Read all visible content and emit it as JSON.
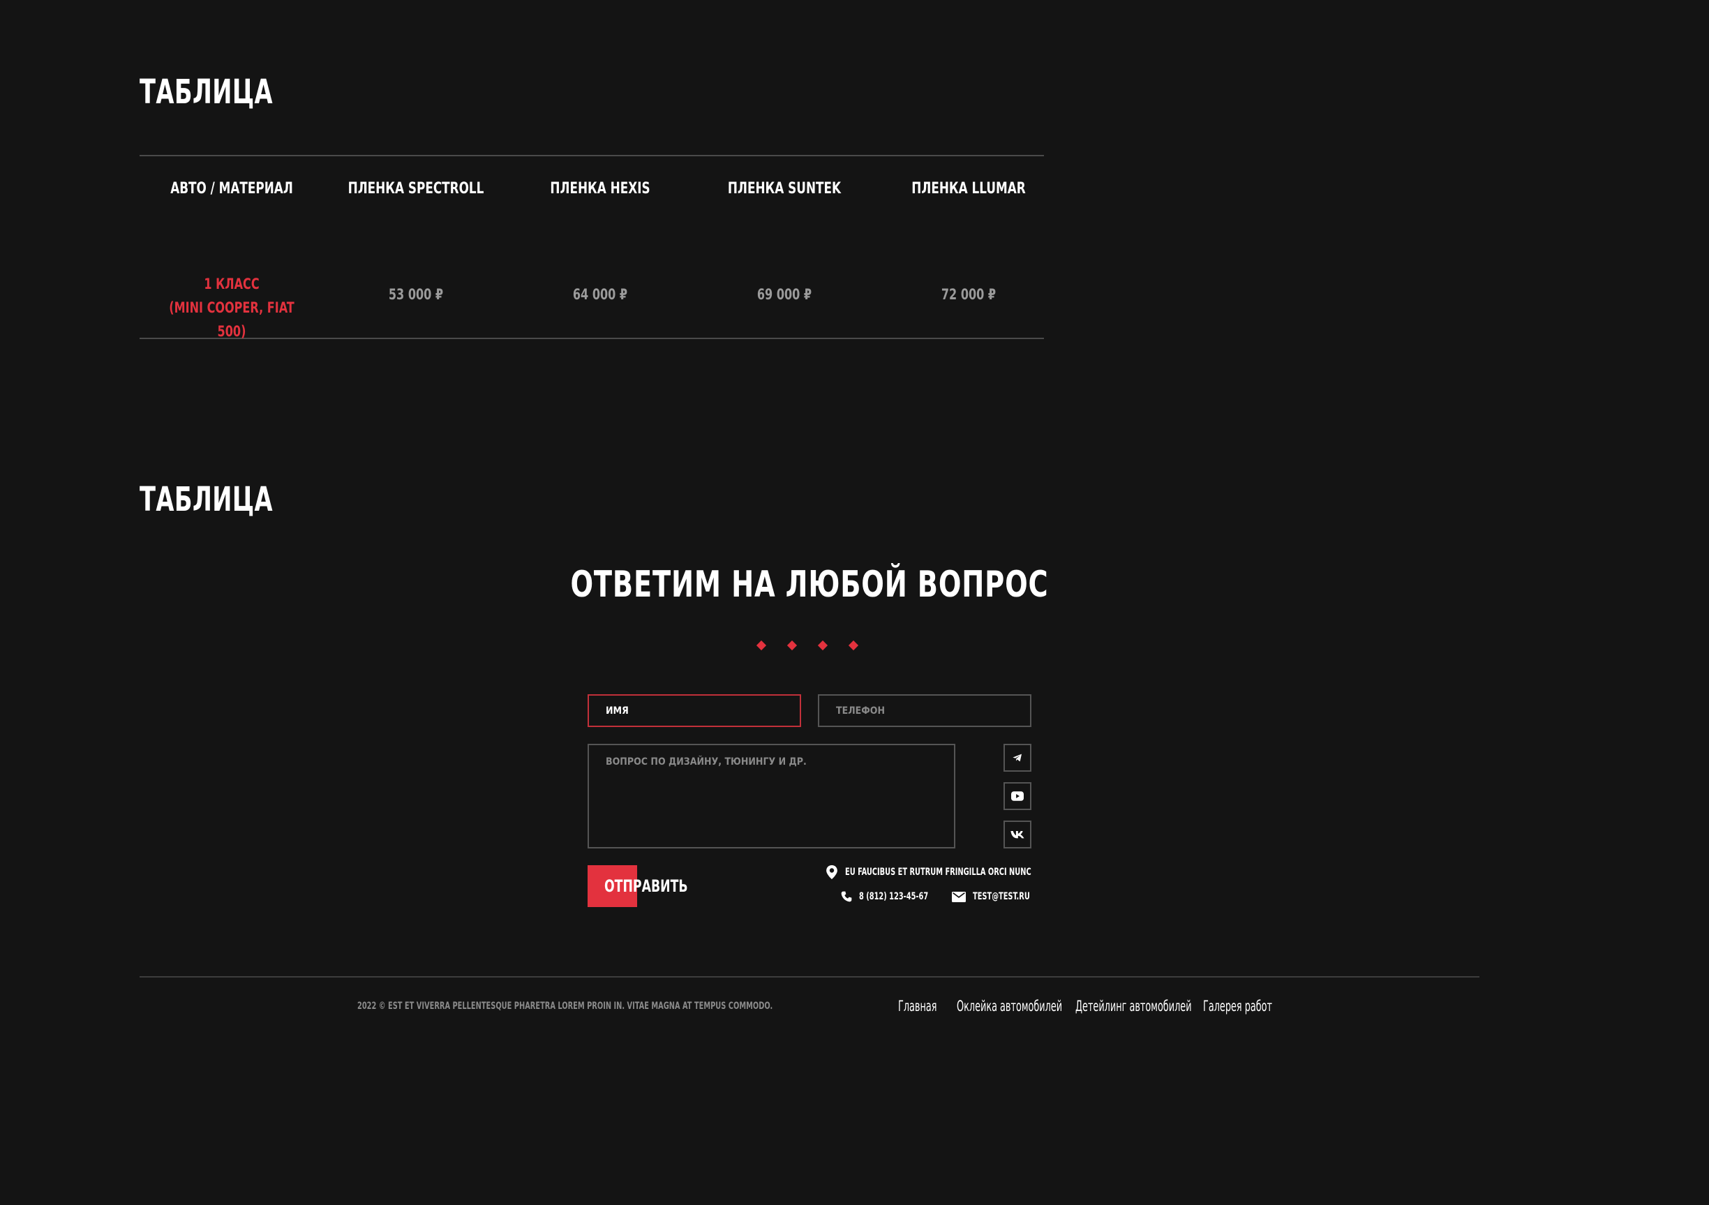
{
  "sections": [
    {
      "title": "ТАБЛИЦА"
    },
    {
      "title": "ТАБЛИЦА"
    }
  ],
  "table": {
    "headers": [
      "АВТО / МАТЕРИАЛ",
      "ПЛЕНКА SPECTROLL",
      "ПЛЕНКА HEXIS",
      "ПЛЕНКА SUNTEK",
      "ПЛЕНКА LLUMAR"
    ],
    "rows": [
      {
        "class_line1": "1 КЛАСС",
        "class_line2": "(MINI COOPER, FIAT 500)",
        "prices": [
          "53 000 ₽",
          "64 000 ₽",
          "69 000 ₽",
          "72 000 ₽"
        ]
      }
    ]
  },
  "contact": {
    "title": "ОТВЕТИМ НА ЛЮБОЙ ВОПРОС",
    "name_value": "ИМЯ",
    "phone_placeholder": "ТЕЛЕФОН",
    "question_placeholder": "ВОПРОС ПО ДИЗАЙНУ, ТЮНИНГУ И ДР.",
    "submit_label": "ОТПРАВИТЬ",
    "address": "EU FAUCIBUS ET RUTRUM FRINGILLA ORCI NUNC",
    "phone": "8 (812) 123-45-67",
    "email": "TEST@TEST.RU",
    "social": [
      "telegram-icon",
      "youtube-icon",
      "vk-icon"
    ]
  },
  "footer": {
    "copyright": "2022 © EST ET VIVERRA PELLENTESQUE PHARETRA LOREM PROIN IN. VITAE MAGNA AT TEMPUS COMMODO.",
    "links": [
      "Главная",
      "Оклейка автомобилей",
      "Детейлинг автомобилей",
      "Галерея работ"
    ]
  },
  "colors": {
    "background": "#141414",
    "accent": "#e3323e",
    "text": "#ffffff",
    "muted": "#9b9b9b",
    "border": "#555555"
  }
}
